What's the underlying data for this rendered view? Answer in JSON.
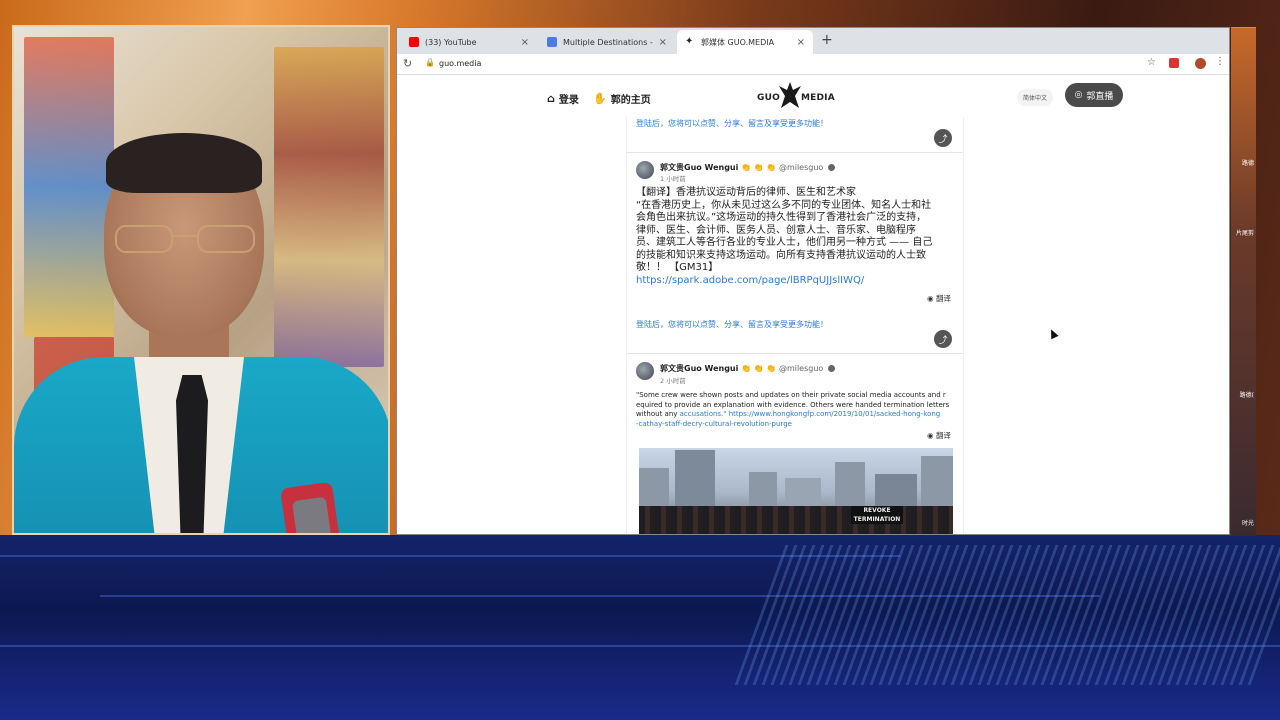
{
  "browser": {
    "tabs": [
      {
        "label": "(33) YouTube",
        "favicon_color": "#ff0000",
        "active": false
      },
      {
        "label": "Multiple Destinations - Freedo",
        "favicon_color": "#4a7be0",
        "active": false
      },
      {
        "label": "郭媒体 GUO.MEDIA",
        "favicon_color": "#222222",
        "active": true
      }
    ],
    "new_tab_symbol": "+",
    "close_symbol": "×",
    "url": "guo.media"
  },
  "site": {
    "nav_login": "登录",
    "nav_home": "郭的主页",
    "logo_left": "GUO",
    "logo_right": "MEDIA",
    "lang": "简体中文",
    "live": "郭直播"
  },
  "feed": {
    "login_hint": "登陆后，您将可以点赞、分享、留言及享受更多功能！",
    "translate_label": "翻译",
    "posts": [
      {
        "author": "郭文贵Guo Wengui",
        "emojis": "👏 👏 👏",
        "handle": "@milesguo",
        "time": "1 小时前",
        "line1": "【翻译】香港抗议运动背后的律师、医生和艺术家",
        "line2": "“在香港历史上，你从未见过这么多不同的专业团体、知名人士和社",
        "line3": "会角色出来抗议。”这场运动的持久性得到了香港社会广泛的支持，",
        "line4": "律师、医生、会计师、医务人员、创意人士、音乐家、电脑程序",
        "line5": "员、建筑工人等各行各业的专业人士，他们用另一种方式 —— 自己",
        "line6": "的技能和知识来支持这场运动。向所有支持香港抗议运动的人士致",
        "line7": "敬！！ 【GM31】",
        "link": "https://spark.adobe.com/page/lBRPqUJJslIWQ/"
      },
      {
        "author": "郭文贵Guo Wengui",
        "emojis": "👏 👏 👏",
        "handle": "@milesguo",
        "time": "2 小时前",
        "line1": "\"Some crew were shown posts and updates on their private social media accounts and r",
        "line2": "equired to provide an explanation with evidence. Others were handed termination letters",
        "line3_plain": "without any ",
        "line3_link": "accusations.\" https://www.hongkongfp.com/2019/10/01/sacked-hong-kong",
        "line4_link": "-cathay-staff-decry-cultural-revolution-purge",
        "image_banner": "REVOKE TERMINATION"
      }
    ]
  },
  "desktop": {
    "labels": [
      "路德",
      "片尾剪",
      "路德(",
      "时光"
    ]
  }
}
